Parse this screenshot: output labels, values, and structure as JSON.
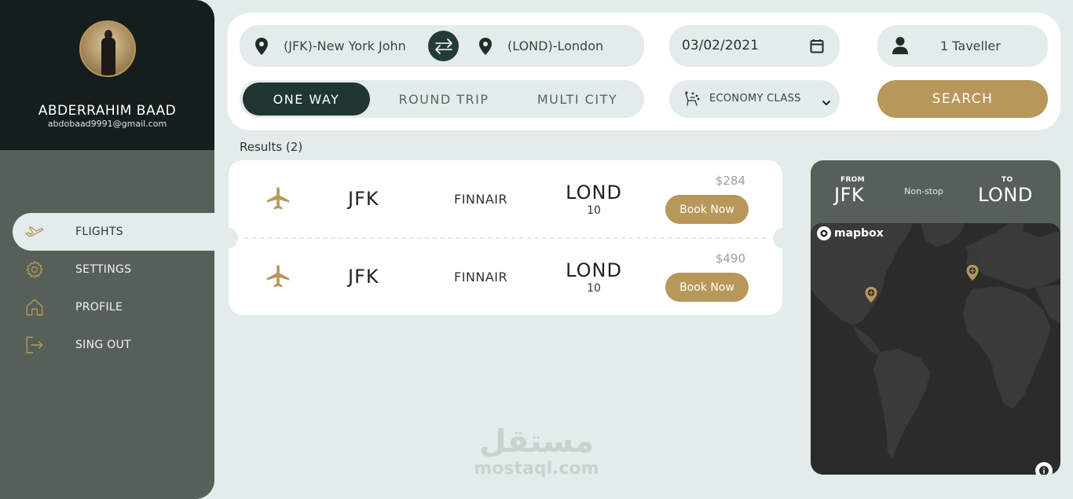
{
  "user": {
    "name": "ABDERRAHIM BAAD",
    "email": "abdobaad9991@gmail.com"
  },
  "sidebar": {
    "items": [
      {
        "label": "FLIGHTS",
        "icon": "plane-icon",
        "active": true
      },
      {
        "label": "SETTINGS",
        "icon": "gear-icon",
        "active": false
      },
      {
        "label": "PROFILE",
        "icon": "home-icon",
        "active": false
      },
      {
        "label": "SING OUT",
        "icon": "sign-out-icon",
        "active": false
      }
    ]
  },
  "search": {
    "from": "(JFK)-New York John",
    "to": "(LOND)-London",
    "date": "03/02/2021",
    "travellers": "1 Taveller",
    "trip_types": [
      "ONE WAY",
      "ROUND TRIP",
      "MULTI CITY"
    ],
    "selected_trip_type": "ONE WAY",
    "cabin_class": "ECONOMY CLASS",
    "search_label": "SEARCH"
  },
  "results": {
    "label": "Results (2)",
    "flights": [
      {
        "from": "JFK",
        "airline": "FINNAIR",
        "to": "LOND",
        "to_sub": "10",
        "price": "$284",
        "book_label": "Book Now"
      },
      {
        "from": "JFK",
        "airline": "FINNAIR",
        "to": "LOND",
        "to_sub": "10",
        "price": "$490",
        "book_label": "Book Now"
      }
    ]
  },
  "map": {
    "from_label": "FROM",
    "from_code": "JFK",
    "to_label": "TO",
    "to_code": "LOND",
    "stops": "Non-stop",
    "provider": "mapbox"
  },
  "watermark": {
    "arabic": "مستقل",
    "latin": "mostaql.com"
  },
  "colors": {
    "accent": "#b8975a",
    "dark": "#141e1c",
    "sidebar": "#566058",
    "background": "#e3ecea"
  }
}
